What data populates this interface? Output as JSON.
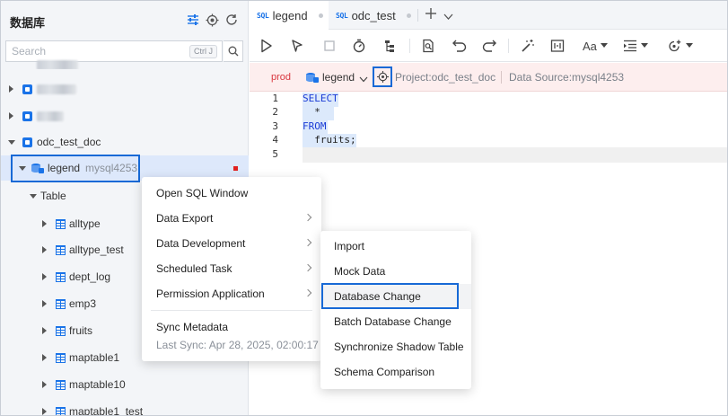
{
  "sidebar": {
    "title": "数据库",
    "search_placeholder": "Search",
    "search_shortcut": "Ctrl J",
    "tree": {
      "connection": {
        "label": "odc_test_doc"
      },
      "database": {
        "name": "legend",
        "source": "mysql4253"
      },
      "table_group": "Table",
      "tables": [
        "alltype",
        "alltype_test",
        "dept_log",
        "emp3",
        "fruits",
        "maptable1",
        "maptable10",
        "maptable1_test"
      ]
    }
  },
  "tabs": [
    {
      "badge": "SQL",
      "label": "legend"
    },
    {
      "badge": "SQL",
      "label": "odc_test"
    }
  ],
  "infobar": {
    "env": "prod",
    "database": "legend",
    "project": "Project:odc_test_doc",
    "datasource": "Data Source:mysql4253"
  },
  "editor": {
    "lines": [
      {
        "no": "1",
        "text": "SELECT"
      },
      {
        "no": "2",
        "text": "  *"
      },
      {
        "no": "3",
        "text": "FROM"
      },
      {
        "no": "4",
        "text": "  fruits;"
      },
      {
        "no": "5",
        "text": ""
      }
    ]
  },
  "context_menu": {
    "items": [
      "Open SQL Window",
      "Data Export",
      "Data Development",
      "Scheduled Task",
      "Permission Application"
    ],
    "sync_label": "Sync Metadata",
    "last_sync": "Last Sync: Apr 28, 2025, 02:00:17"
  },
  "submenu": {
    "items": [
      "Import",
      "Mock Data",
      "Database Change",
      "Batch Database Change",
      "Synchronize Shadow Table",
      "Schema Comparison"
    ]
  },
  "toolbar": {
    "format_label": "Aa"
  },
  "colors": {
    "accent": "#1769d6",
    "prod": "#d9363e",
    "infobar_bg": "#fdeeee"
  }
}
